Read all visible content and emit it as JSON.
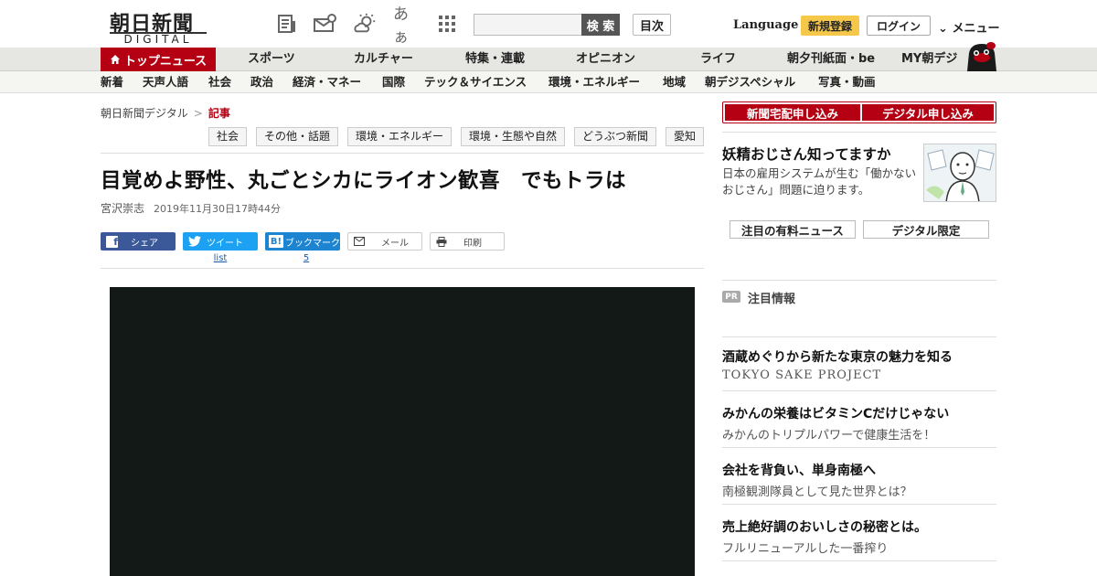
{
  "header": {
    "logo_main": "朝日新聞",
    "logo_sub": "DIGITAL",
    "icons": [
      "newspaper-icon",
      "mail-icon",
      "weather-icon",
      "font-size-icon",
      "apps-grid-icon"
    ],
    "font_size_label": "あぁ",
    "search_placeholder": "",
    "search_button": "検 索",
    "toc_button": "目次",
    "language": "Language",
    "register": "新規登録",
    "login": "ログイン",
    "menu": "メニュー"
  },
  "mainnav": {
    "top_news": "トップニュース",
    "items": [
      "スポーツ",
      "カルチャー",
      "特集・連載",
      "オピニオン",
      "ライフ",
      "朝夕刊紙面・be",
      "MY朝デジ"
    ]
  },
  "subnav": {
    "items": [
      "新着",
      "天声人語",
      "社会",
      "政治",
      "経済・マネー",
      "国際",
      "テック＆サイエンス",
      "環境・エネルギー",
      "地域",
      "朝デジスペシャル",
      "写真・動画"
    ]
  },
  "article": {
    "breadcrumb": {
      "home": "朝日新聞デジタル",
      "separator": ">",
      "current": "記事"
    },
    "tags": [
      "社会",
      "その他・話題",
      "環境・エネルギー",
      "環境・生態や自然",
      "どうぶつ新聞",
      "愛知"
    ],
    "headline": "目覚めよ野性、丸ごとシカにライオン歓喜　でもトラは",
    "author": "宮沢崇志",
    "date": "2019年11月30日17時44分",
    "share": {
      "facebook": "シェア",
      "twitter": "ツイート",
      "hatena_icon": "B!",
      "hatena": "ブックマーク",
      "mail": "メール",
      "print": "印刷",
      "twitter_count": "list",
      "hatena_count": "5"
    }
  },
  "sidebar": {
    "subscribe_paper": "新聞宅配申し込み",
    "subscribe_digital": "デジタル申し込み",
    "promo_title": "妖精おじさん知ってますか",
    "promo_desc": "日本の雇用システムが生む「働かないおじさん」問題に迫ります。",
    "btn_featured": "注目の有料ニュース",
    "btn_digital": "デジタル限定",
    "pr_badge": "PR",
    "pr_heading": "注目情報",
    "pr_items": [
      {
        "title": "酒蔵めぐりから新たな東京の魅力を知る",
        "sub": "TOKYO SAKE PROJECT"
      },
      {
        "title": "みかんの栄養はビタミンCだけじゃない",
        "sub": "みかんのトリプルパワーで健康生活を！"
      },
      {
        "title": "会社を背負い、単身南極へ",
        "sub": "南極観測隊員として見た世界とは？"
      },
      {
        "title": "売上絶好調のおいしさの秘密とは。",
        "sub": "フルリニューアルした一番搾り"
      }
    ]
  },
  "colors": {
    "brand_red": "#b40012",
    "register_yellow": "#f5c84a",
    "photo_bg": "#131917"
  }
}
